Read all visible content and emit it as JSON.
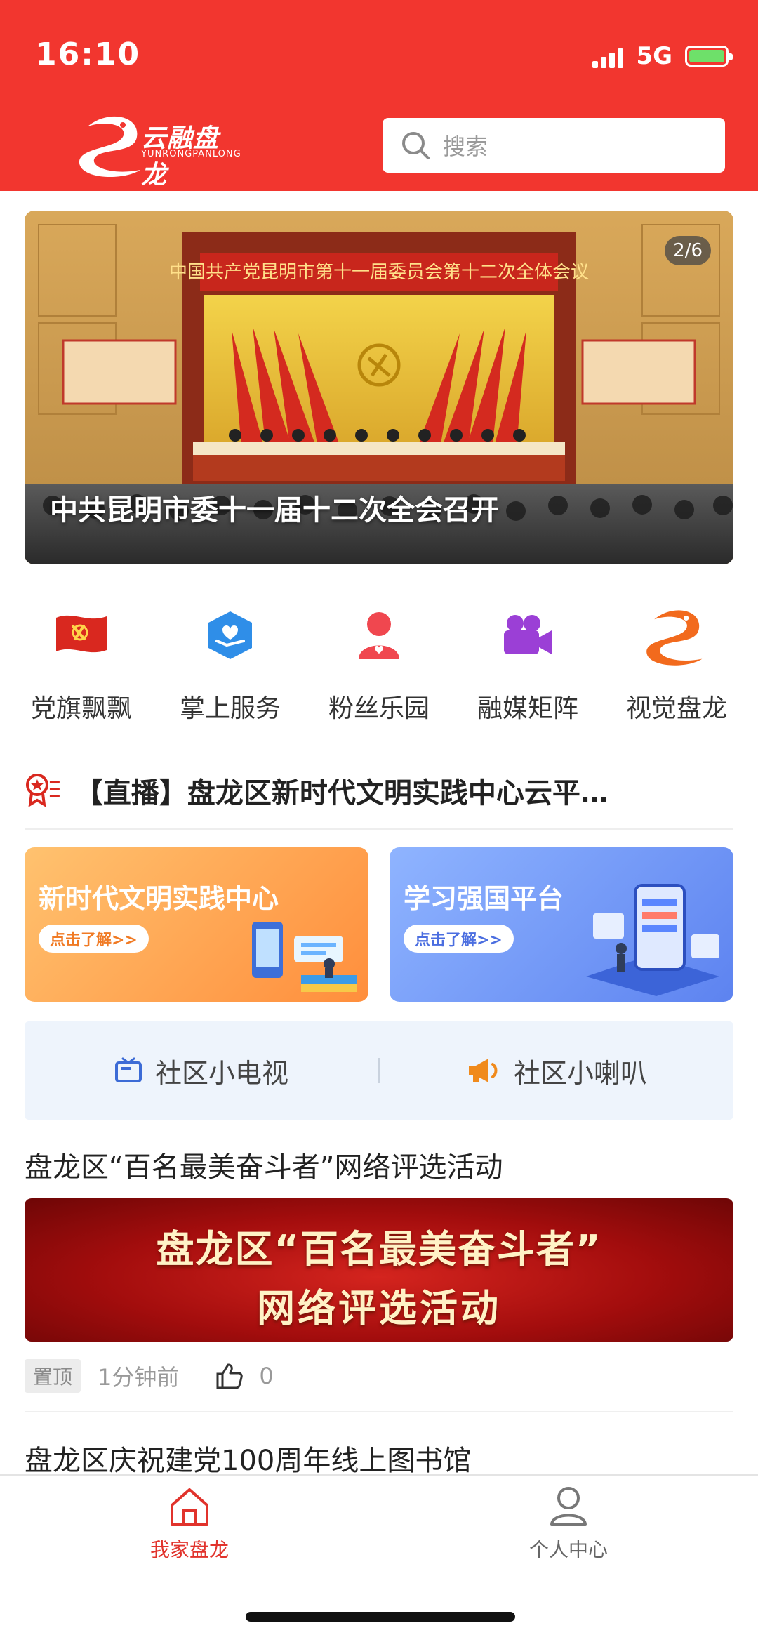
{
  "status_bar": {
    "time": "16:10",
    "network": "5G"
  },
  "header": {
    "logo_text": "云融盘龙",
    "logo_sub": "YUNRONGPANLONG",
    "search_placeholder": "搜索"
  },
  "banner": {
    "counter": "2/6",
    "hall_banner": "中国共产党昆明市第十一届委员会第十二次全体会议",
    "side_board": "中国共产党 昆明市第十一届委员会 第十二次全体会议",
    "caption": "中共昆明市委十一届十二次全会召开"
  },
  "quick_nav": [
    {
      "icon": "party-flag-icon",
      "label": "党旗飘飘"
    },
    {
      "icon": "service-hand-icon",
      "label": "掌上服务"
    },
    {
      "icon": "fans-person-icon",
      "label": "粉丝乐园"
    },
    {
      "icon": "video-camera-icon",
      "label": "融媒矩阵"
    },
    {
      "icon": "dragon-logo-icon",
      "label": "视觉盘龙"
    }
  ],
  "ticker": {
    "text": "【直播】盘龙区新时代文明实践中心云平…"
  },
  "promos": [
    {
      "title": "新时代文明实践中心",
      "button": "点击了解>>"
    },
    {
      "title": "学习强国平台",
      "button": "点击了解>>"
    }
  ],
  "community": [
    {
      "icon": "tv-icon",
      "label": "社区小电视"
    },
    {
      "icon": "megaphone-icon",
      "label": "社区小喇叭"
    }
  ],
  "news": [
    {
      "title": "盘龙区“百名最美奋斗者”网络评选活动",
      "image_line1": "盘龙区“百名最美奋斗者”",
      "image_line2": "网络评选活动",
      "badge": "置顶",
      "time": "1分钟前",
      "likes": "0"
    },
    {
      "title": "盘龙区庆祝建党100周年线上图书馆"
    }
  ],
  "tabbar": [
    {
      "icon": "home-icon",
      "label": "我家盘龙",
      "active": true
    },
    {
      "icon": "user-icon",
      "label": "个人中心",
      "active": false
    }
  ],
  "colors": {
    "brand_red": "#f2362f",
    "active_tab": "#e1332c",
    "community_bg": "#eef4fc"
  }
}
